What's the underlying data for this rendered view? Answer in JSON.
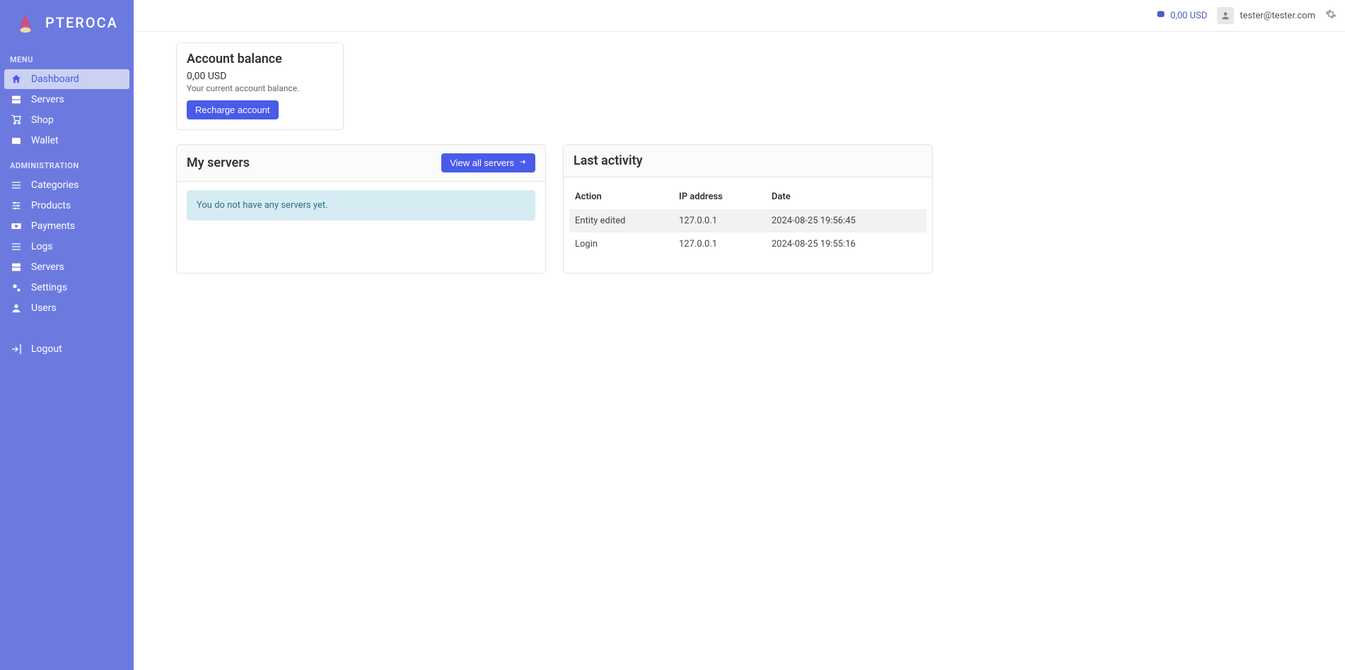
{
  "brand": "PTEROCA",
  "sidebar": {
    "menu_title": "MENU",
    "menu_items": [
      {
        "label": "Dashboard"
      },
      {
        "label": "Servers"
      },
      {
        "label": "Shop"
      },
      {
        "label": "Wallet"
      }
    ],
    "admin_title": "ADMINISTRATION",
    "admin_items": [
      {
        "label": "Categories"
      },
      {
        "label": "Products"
      },
      {
        "label": "Payments"
      },
      {
        "label": "Logs"
      },
      {
        "label": "Servers"
      },
      {
        "label": "Settings"
      },
      {
        "label": "Users"
      }
    ],
    "logout_label": "Logout"
  },
  "topbar": {
    "balance": "0,00 USD",
    "user_email": "tester@tester.com"
  },
  "balance_card": {
    "title": "Account balance",
    "value": "0,00 USD",
    "description": "Your current account balance.",
    "button": "Recharge account"
  },
  "servers_card": {
    "title": "My servers",
    "view_all": "View all servers",
    "empty_message": "You do not have any servers yet."
  },
  "activity_card": {
    "title": "Last activity",
    "columns": {
      "action": "Action",
      "ip": "IP address",
      "date": "Date"
    },
    "rows": [
      {
        "action": "Entity edited",
        "ip": "127.0.0.1",
        "date": "2024-08-25 19:56:45"
      },
      {
        "action": "Login",
        "ip": "127.0.0.1",
        "date": "2024-08-25 19:55:16"
      }
    ]
  }
}
